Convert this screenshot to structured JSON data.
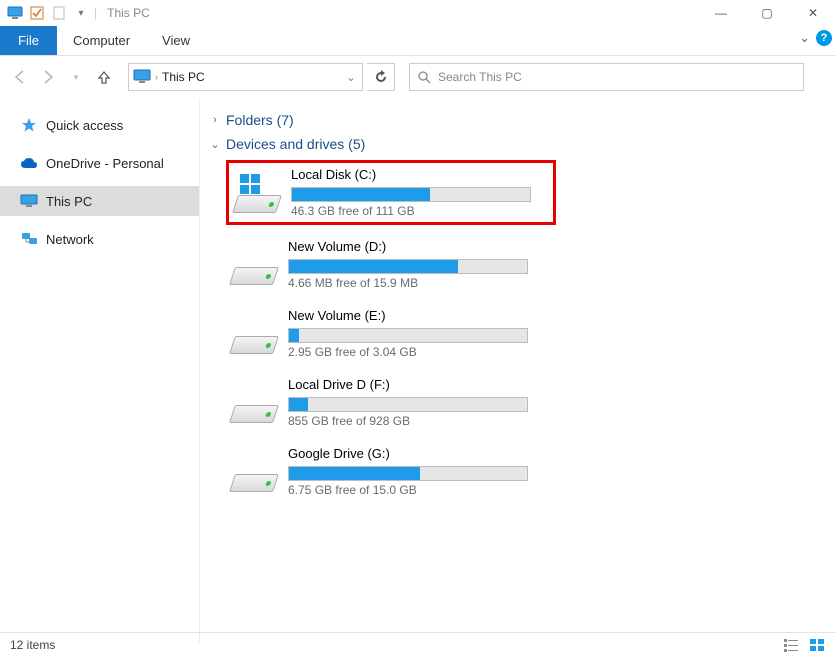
{
  "window": {
    "title": "This PC",
    "controls": {
      "min": "—",
      "max": "▢",
      "close": "✕"
    }
  },
  "ribbon": {
    "file": "File",
    "tabs": [
      "Computer",
      "View"
    ],
    "expand": "⌄"
  },
  "navbar": {
    "addr_current": "This PC",
    "search_placeholder": "Search This PC"
  },
  "sidebar": {
    "items": [
      {
        "label": "Quick access",
        "icon": "star-icon",
        "selected": false
      },
      {
        "label": "OneDrive - Personal",
        "icon": "cloud-icon",
        "selected": false
      },
      {
        "label": "This PC",
        "icon": "pc-icon",
        "selected": true
      },
      {
        "label": "Network",
        "icon": "network-icon",
        "selected": false
      }
    ]
  },
  "content": {
    "folders_header": "Folders (7)",
    "drives_header": "Devices and drives (5)",
    "drives": [
      {
        "name": "Local Disk (C:)",
        "free": "46.3 GB free of 111 GB",
        "fill_pct": 58,
        "os": true,
        "highlight": true
      },
      {
        "name": "New Volume (D:)",
        "free": "4.66 MB free of 15.9 MB",
        "fill_pct": 71,
        "os": false,
        "highlight": false
      },
      {
        "name": "New Volume (E:)",
        "free": "2.95 GB free of 3.04 GB",
        "fill_pct": 4,
        "os": false,
        "highlight": false
      },
      {
        "name": "Local Drive D (F:)",
        "free": "855 GB free of 928 GB",
        "fill_pct": 8,
        "os": false,
        "highlight": false
      },
      {
        "name": "Google Drive (G:)",
        "free": "6.75 GB free of 15.0 GB",
        "fill_pct": 55,
        "os": false,
        "highlight": false
      }
    ]
  },
  "status": {
    "text": "12 items"
  }
}
